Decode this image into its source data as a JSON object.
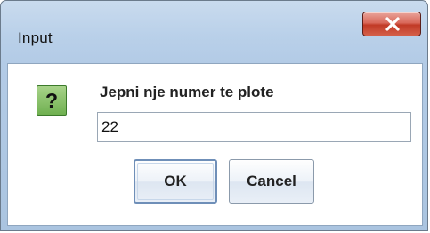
{
  "dialog": {
    "title": "Input",
    "close_label": "X",
    "message": "Jepni nje numer te plote",
    "input_value": "22",
    "question_symbol": "?",
    "ok_label": "OK",
    "cancel_label": "Cancel"
  },
  "icons": {
    "close": "close-icon",
    "question": "question-icon"
  },
  "colors": {
    "title_bar": "#b9d0e9",
    "close_button": "#c13a26",
    "question_icon": "#6fb050",
    "default_button_border": "#6f8fb8"
  }
}
